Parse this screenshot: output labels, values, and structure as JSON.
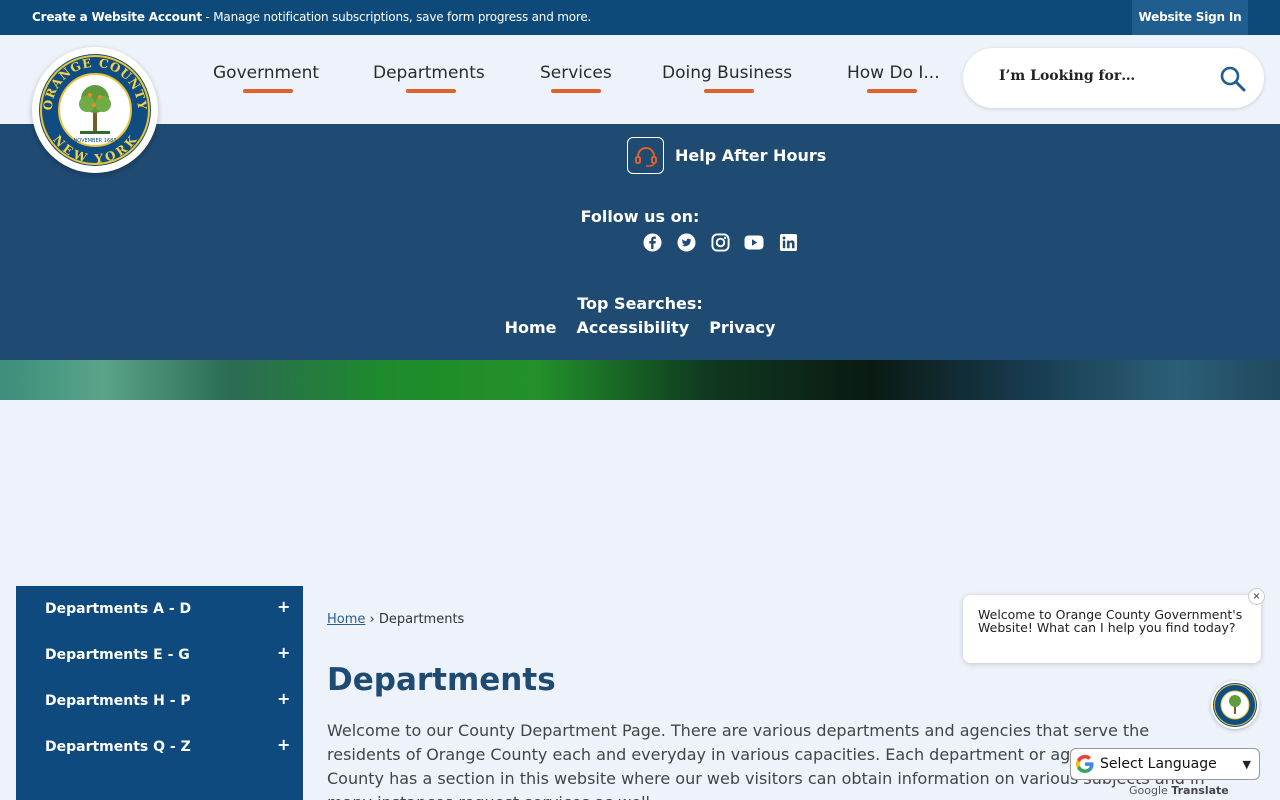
{
  "topbar": {
    "create_account_bold": "Create a Website Account",
    "create_account_text": " - Manage notification subscriptions, save form progress and more.",
    "signin_label": "Website Sign In"
  },
  "logo": {
    "text_top": "ORANGE COUNTY",
    "text_bottom": "NEW YORK",
    "text_date": "NOVEMBER 1683"
  },
  "nav": {
    "items": [
      {
        "label": "Government"
      },
      {
        "label": "Departments"
      },
      {
        "label": "Services"
      },
      {
        "label": "Doing Business"
      },
      {
        "label": "How Do I..."
      }
    ]
  },
  "search": {
    "placeholder": "I’m Looking for…",
    "icon": "search-icon"
  },
  "band": {
    "help_label": "Help After Hours",
    "follow_label": "Follow us on:",
    "social": [
      "facebook-icon",
      "twitter-icon",
      "instagram-icon",
      "youtube-icon",
      "linkedin-icon"
    ],
    "top_searches_label": "Top Searches:",
    "quick_links": [
      "Home",
      "Accessibility",
      "Privacy"
    ]
  },
  "sidebar": {
    "items": [
      {
        "label": "Departments A - D",
        "toggle": "+"
      },
      {
        "label": "Departments E - G",
        "toggle": "+"
      },
      {
        "label": "Departments H - P",
        "toggle": "+"
      },
      {
        "label": "Departments Q - Z",
        "toggle": "+"
      }
    ]
  },
  "content": {
    "breadcrumb_home": "Home",
    "breadcrumb_sep": "›",
    "breadcrumb_current": "Departments",
    "title": "Departments",
    "intro": "Welcome to our County Department Page. There are various departments and agencies that serve the residents of Orange County each and everyday in various capacities. Each department or agency in Orange County has a section in this website where our web visitors can obtain information on various subjects and in many instances request services as well."
  },
  "chat": {
    "message": "Welcome to Orange County Government's Website! What can I help you find today?",
    "close": "×"
  },
  "translate": {
    "label": "Select Language",
    "powered_prefix": "Google",
    "powered_suffix": "Translate"
  },
  "colors": {
    "topbar": "#0d4a7a",
    "band": "#1f4a72",
    "sidebar": "#0e4a7d",
    "accent": "#e0612a"
  }
}
